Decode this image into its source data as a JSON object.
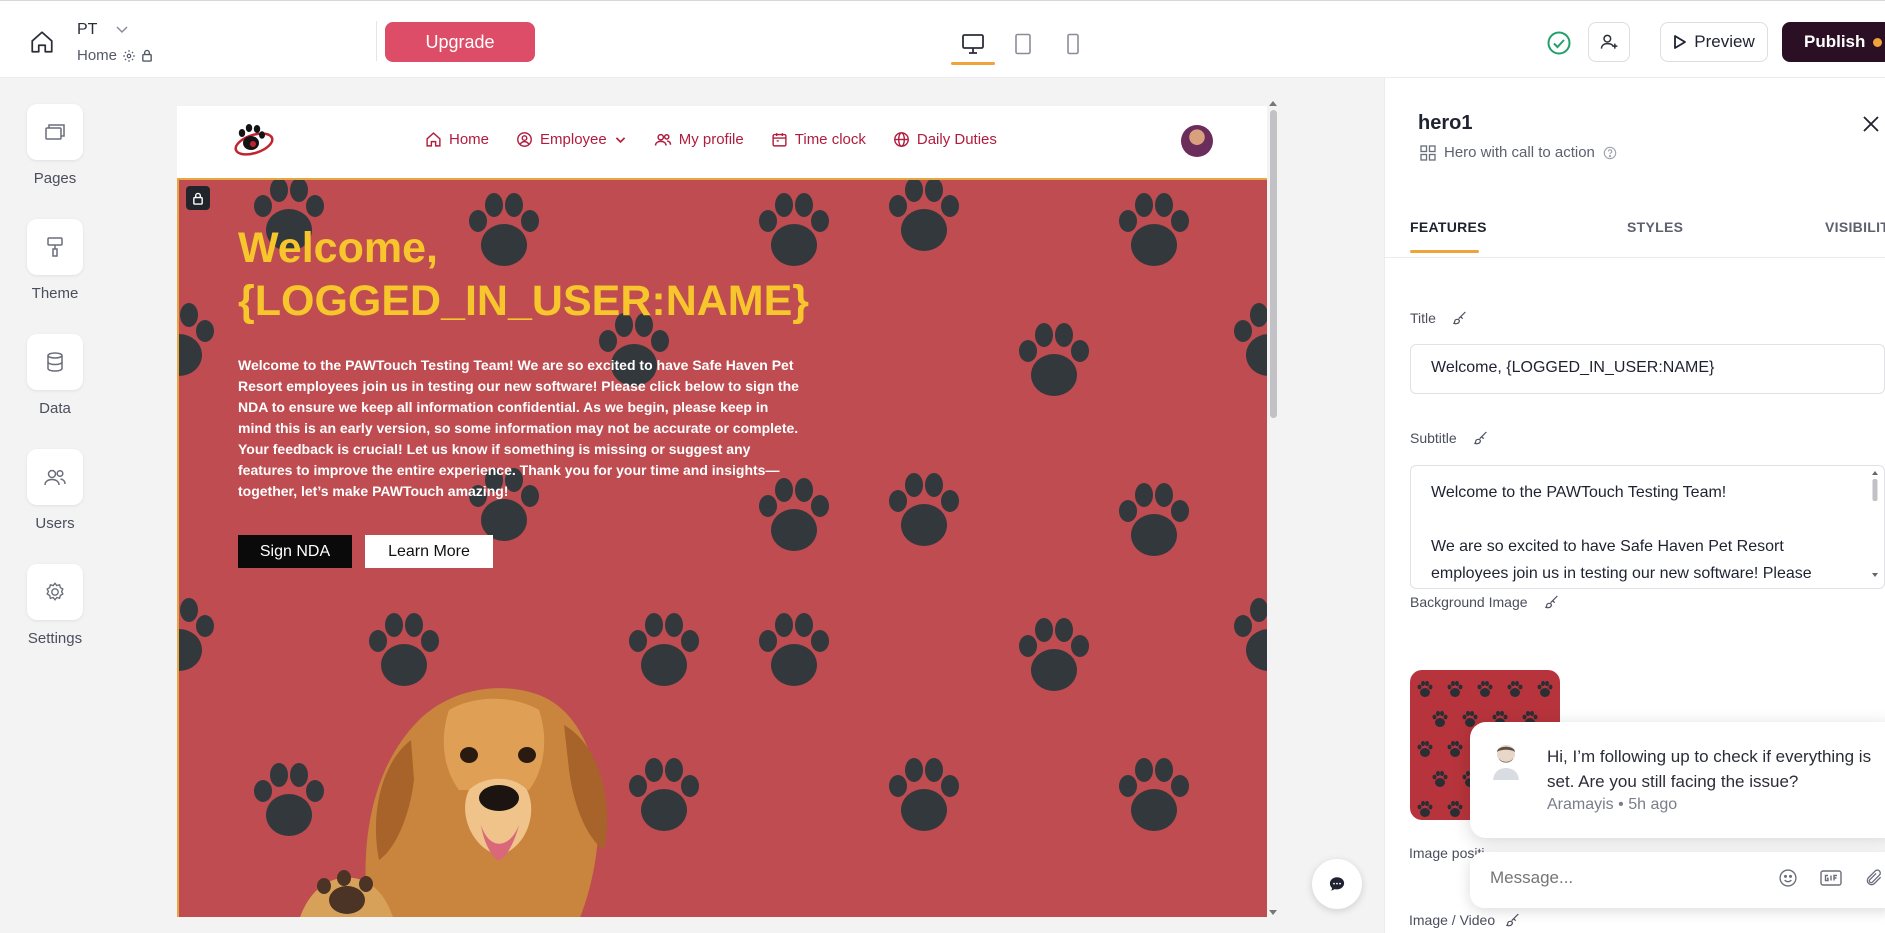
{
  "topbar": {
    "site_name": "PT",
    "page_name": "Home",
    "upgrade_label": "Upgrade",
    "preview_label": "Preview",
    "publish_label": "Publish",
    "device_active": "desktop"
  },
  "rail": {
    "items": [
      {
        "label": "Pages",
        "icon": "pages-icon"
      },
      {
        "label": "Theme",
        "icon": "paint-roller-icon"
      },
      {
        "label": "Data",
        "icon": "database-icon"
      },
      {
        "label": "Users",
        "icon": "users-icon"
      },
      {
        "label": "Settings",
        "icon": "gear-icon"
      }
    ]
  },
  "site": {
    "nav": [
      {
        "label": "Home",
        "icon": "home-icon"
      },
      {
        "label": "Employee",
        "icon": "user-circle-icon",
        "dropdown": true
      },
      {
        "label": "My profile",
        "icon": "users-icon"
      },
      {
        "label": "Time clock",
        "icon": "calendar-icon"
      },
      {
        "label": "Daily Duties",
        "icon": "globe-icon"
      }
    ],
    "accent": "#b01d3e"
  },
  "hero": {
    "title": "Welcome, {LOGGED_IN_USER:NAME}",
    "subtitle": "Welcome to the PAWTouch Testing Team! We are so excited to have Safe Haven Pet Resort employees join us in testing our new software! Please click below to sign the NDA to ensure we keep all information confidential. As we begin, please keep in mind this is an early version, so some information may not be accurate or complete. Your feedback is crucial! Let us know if something is missing or suggest any features to improve the entire experience. Thank you for your time and insights—together, let’s make PAWTouch amazing!",
    "primary_button": "Sign NDA",
    "secondary_button": "Learn More",
    "title_color": "#f7c52c",
    "bg_color": "#be4c50"
  },
  "panel": {
    "component_name": "hero1",
    "component_type": "Hero with call to action",
    "tabs": [
      "FEATURES",
      "STYLES",
      "VISIBILIT"
    ],
    "active_tab": "FEATURES",
    "title_label": "Title",
    "title_value": "Welcome, {LOGGED_IN_USER:NAME}",
    "subtitle_label": "Subtitle",
    "subtitle_line1": "Welcome to the PAWTouch Testing Team!",
    "subtitle_line2": "We are so excited to have Safe Haven Pet Resort employees join us in testing our new software! Please",
    "bg_image_label": "Background Image",
    "image_position_label": "Image positi",
    "image_video_label": "Image / Video"
  },
  "chat": {
    "message": "Hi, I’m following up to check if everything is set. Are you still facing the issue?",
    "author": "Aramayis",
    "time": "5h ago",
    "separator": "•",
    "input_placeholder": "Message..."
  }
}
